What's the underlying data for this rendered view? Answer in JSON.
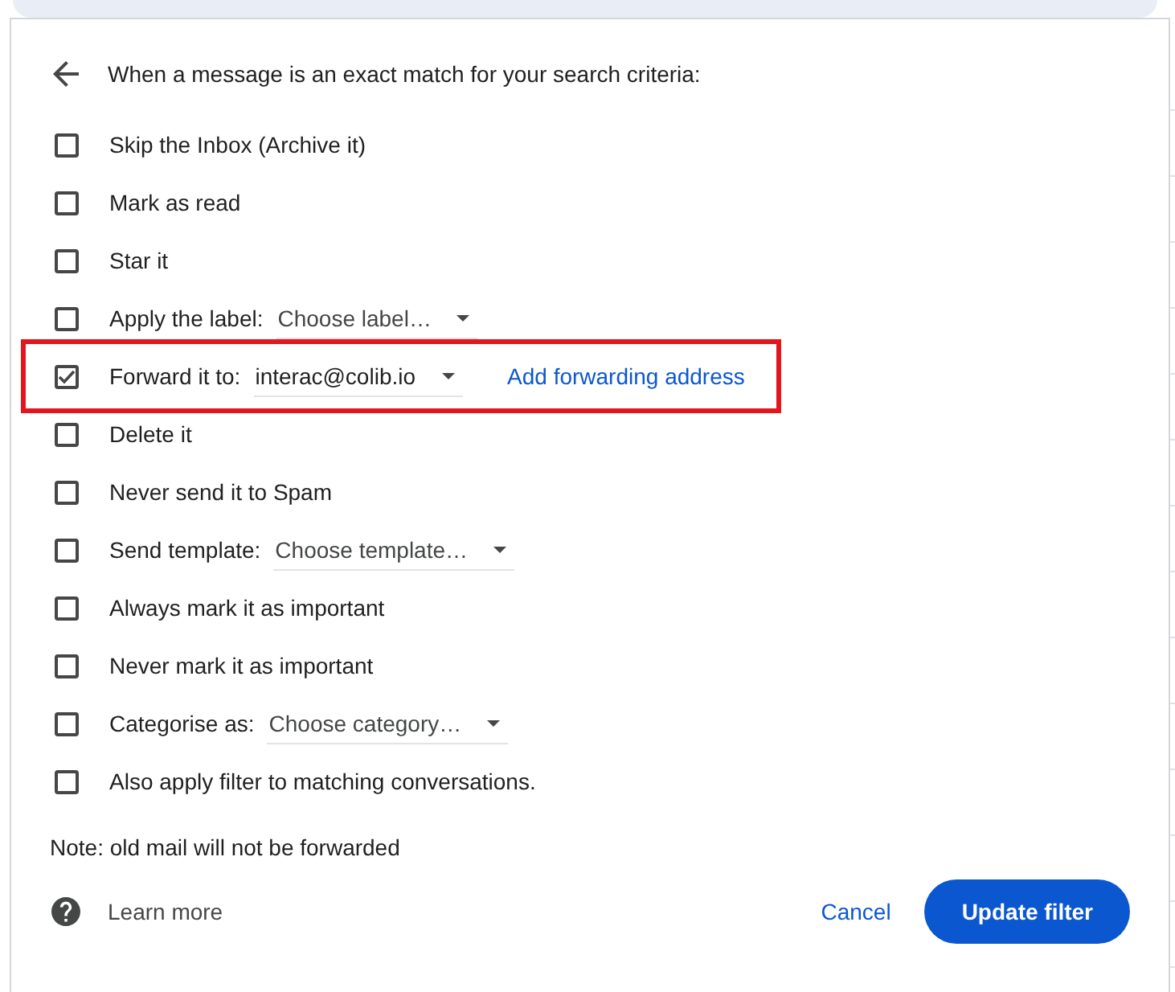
{
  "header": {
    "title": "When a message is an exact match for your search criteria:"
  },
  "actions": [
    {
      "kind": "checkbox",
      "label": "Skip the Inbox (Archive it)",
      "checked": false,
      "highlighted": false
    },
    {
      "kind": "checkbox",
      "label": "Mark as read",
      "checked": false,
      "highlighted": false
    },
    {
      "kind": "checkbox",
      "label": "Star it",
      "checked": false,
      "highlighted": false
    },
    {
      "kind": "select",
      "label": "Apply the label:",
      "placeholder": "Choose label…",
      "checked": false,
      "highlighted": false
    },
    {
      "kind": "select",
      "label": "Forward it to:",
      "value": "interac@colib.io",
      "link": "Add forwarding address",
      "checked": true,
      "highlighted": true
    },
    {
      "kind": "checkbox",
      "label": "Delete it",
      "checked": false,
      "highlighted": false
    },
    {
      "kind": "checkbox",
      "label": "Never send it to Spam",
      "checked": false,
      "highlighted": false
    },
    {
      "kind": "select",
      "label": "Send template:",
      "placeholder": "Choose template…",
      "checked": false,
      "highlighted": false
    },
    {
      "kind": "checkbox",
      "label": "Always mark it as important",
      "checked": false,
      "highlighted": false
    },
    {
      "kind": "checkbox",
      "label": "Never mark it as important",
      "checked": false,
      "highlighted": false
    },
    {
      "kind": "select",
      "label": "Categorise as:",
      "placeholder": "Choose category…",
      "checked": false,
      "highlighted": false
    },
    {
      "kind": "checkbox",
      "label": "Also apply filter to matching conversations.",
      "checked": false,
      "highlighted": false
    }
  ],
  "note": "Note: old mail will not be forwarded",
  "footer": {
    "help_link": "Learn more",
    "buttons": [
      {
        "kind": "text",
        "label": "Cancel"
      },
      {
        "kind": "filled",
        "label": "Update filter"
      }
    ]
  }
}
